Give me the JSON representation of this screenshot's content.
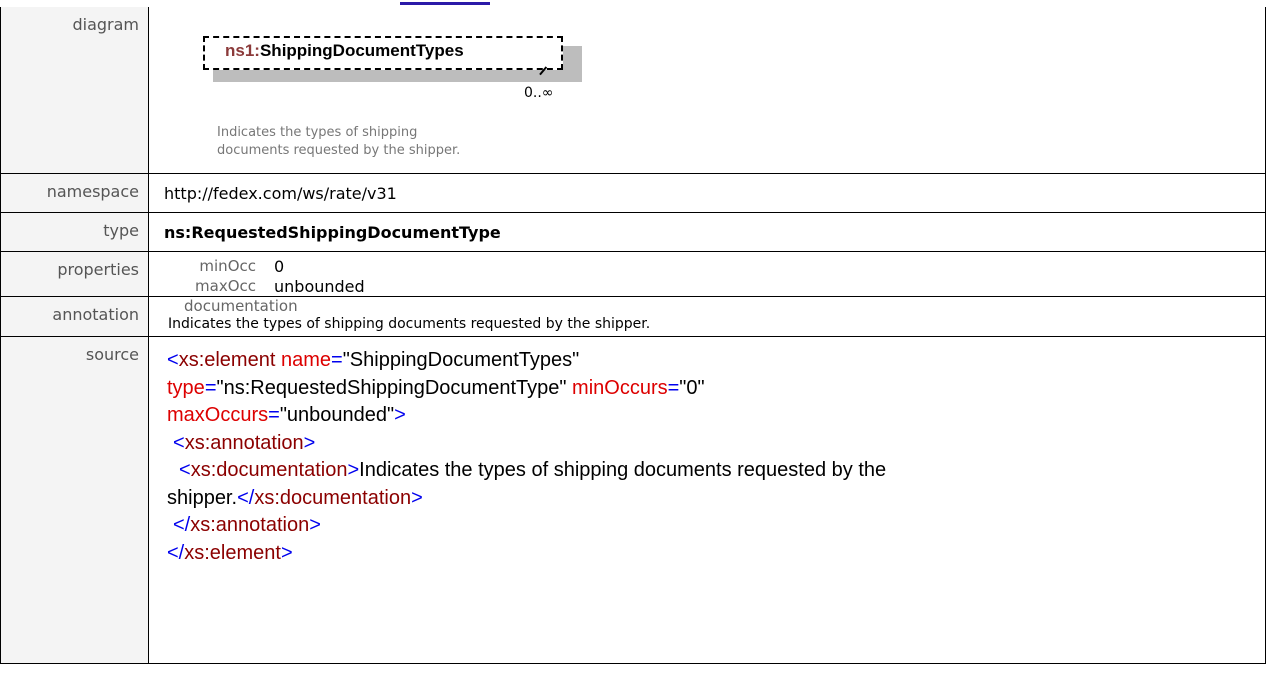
{
  "diagram": {
    "label": "diagram",
    "prefix": "ns1:",
    "element_name": "ShippingDocumentTypes",
    "occurrence": "0..∞",
    "doc_line1": "Indicates the types of shipping",
    "doc_line2": "documents requested by the shipper."
  },
  "namespace": {
    "label": "namespace",
    "value": "http://fedex.com/ws/rate/v31"
  },
  "type": {
    "label": "type",
    "value": "ns:RequestedShippingDocumentType"
  },
  "properties": {
    "label": "properties",
    "min_key": "minOcc",
    "min_val": "0",
    "max_key": "maxOcc",
    "max_val": "unbounded"
  },
  "annotation": {
    "label": "annotation",
    "doc_key": "documentation",
    "doc_text": "Indicates the types of shipping documents requested by the shipper."
  },
  "source": {
    "label": "source",
    "l1_open": "<",
    "l1_el": "xs:element",
    "l1_attr1": " name",
    "l1_eq1": "=",
    "l1_val1": "\"ShippingDocumentTypes\"",
    "l2_attr": "type",
    "l2_eq": "=",
    "l2_val": "\"ns:RequestedShippingDocumentType\"",
    "l2_attr2": " minOccurs",
    "l2_eq2": "=",
    "l2_val2": "\"0\"",
    "l3_attr": "maxOccurs",
    "l3_eq": "=",
    "l3_val": "\"unbounded\"",
    "l3_close": ">",
    "l4_open": "<",
    "l4_el": "xs:annotation",
    "l4_close": ">",
    "l5_open": "<",
    "l5_el": "xs:documentation",
    "l5_close": ">",
    "l5_text": "Indicates the types of shipping documents requested by the",
    "l6_text": "shipper.",
    "l6_open": "</",
    "l6_el": "xs:documentation",
    "l6_close": ">",
    "l7_open": "</",
    "l7_el": "xs:annotation",
    "l7_close": ">",
    "l8_open": "</",
    "l8_el": "xs:element",
    "l8_close": ">"
  }
}
